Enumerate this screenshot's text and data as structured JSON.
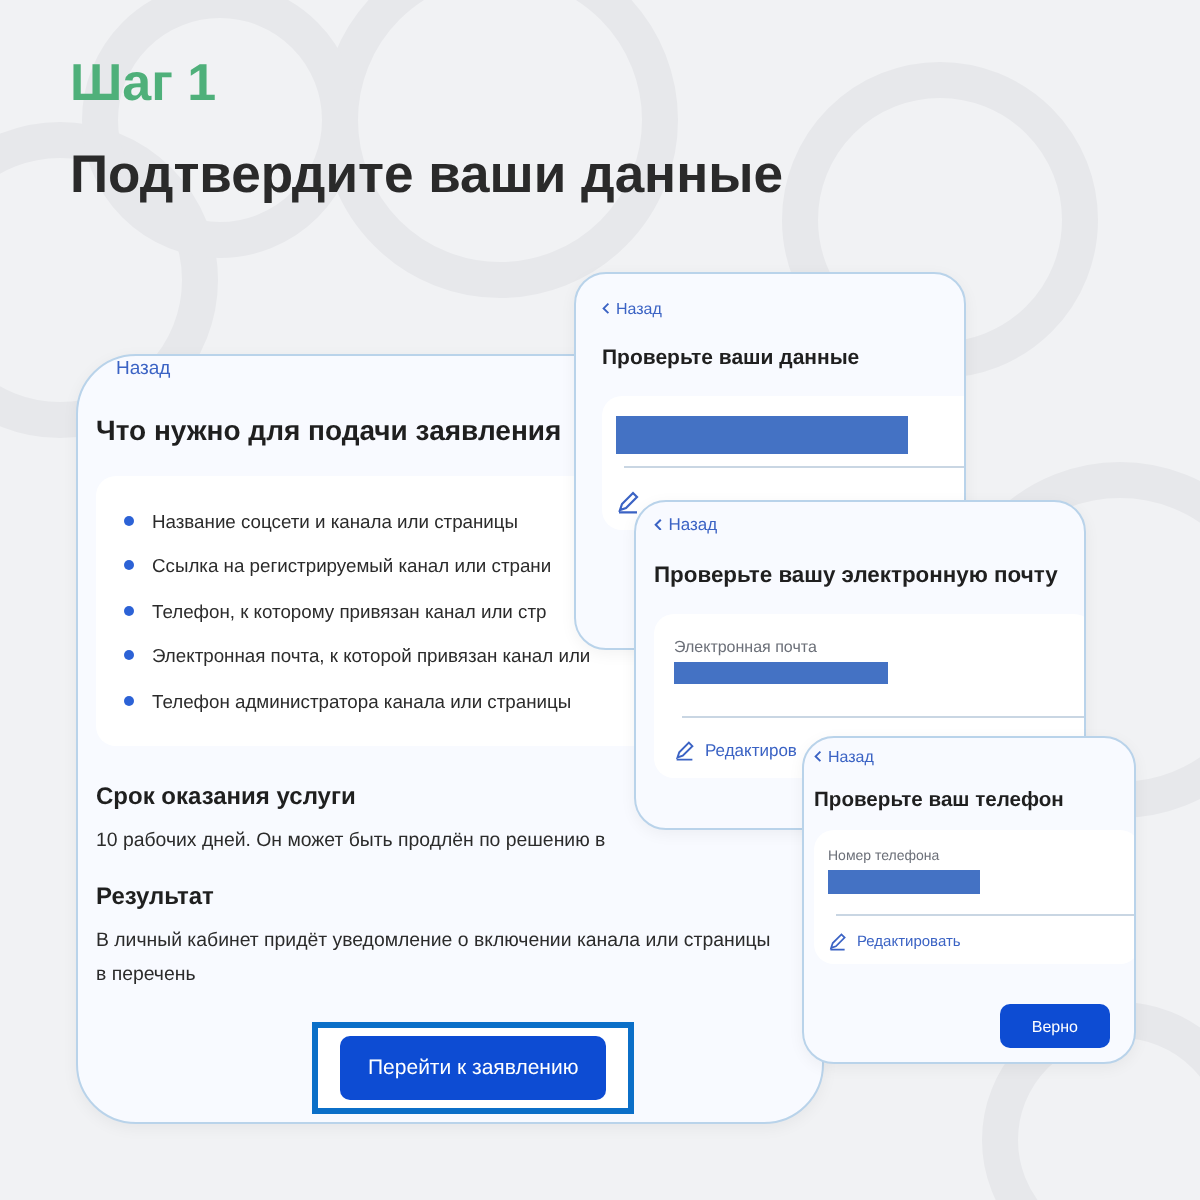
{
  "step": "Шаг 1",
  "heading": "Подтвердите ваши данные",
  "screens": [
    {
      "kind": "requirements",
      "back": "Назад",
      "title": "Что нужно для подачи заявления",
      "items": [
        "Название соцсети и канала или страницы",
        "Ссылка на регистрируемый канал или страни",
        "Телефон, к которому привязан канал или стр",
        "Электронная почта, к которой привязан канал или",
        "Телефон администратора канала или страницы"
      ],
      "sections": [
        {
          "title": "Срок оказания услуги",
          "text": "10 рабочих дней. Он может быть продлён по решению в"
        },
        {
          "title": "Результат",
          "text": "В личный кабинет придёт уведомление о включении канала или страницы\nв перечень"
        }
      ],
      "button": "Перейти к заявлению"
    },
    {
      "kind": "check",
      "back": "Назад",
      "title": "Проверьте ваши данные"
    },
    {
      "kind": "check",
      "back": "Назад",
      "title": "Проверьте вашу электронную почту",
      "label": "Электронная почта",
      "edit": "Редактиров"
    },
    {
      "kind": "check",
      "back": "Назад",
      "title": "Проверьте ваш телефон",
      "label": "Номер телефона",
      "edit": "Редактировать",
      "button": "Верно"
    }
  ]
}
